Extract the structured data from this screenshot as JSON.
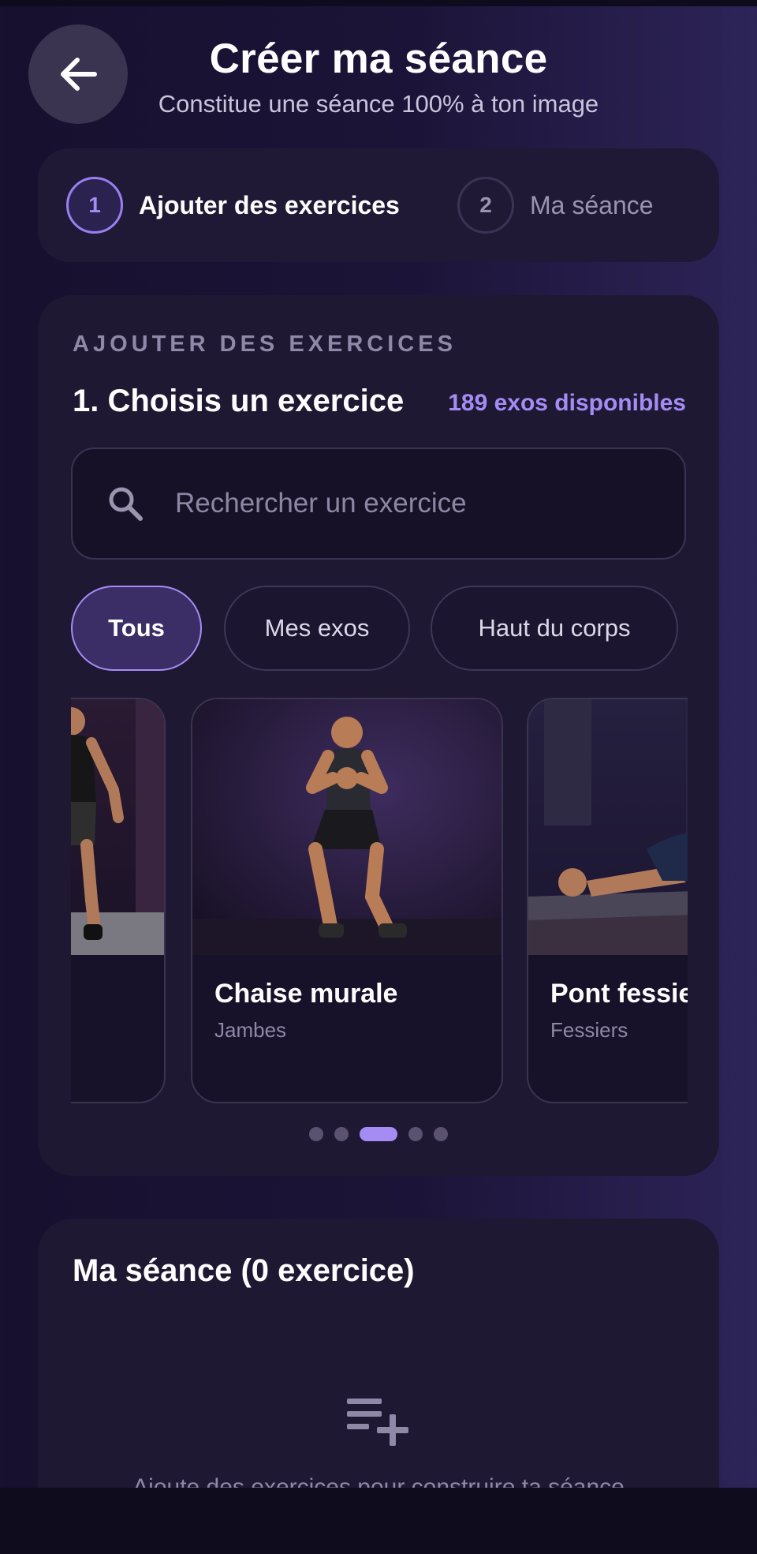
{
  "header": {
    "title": "Créer ma séance",
    "subtitle": "Constitue une séance 100% à ton image"
  },
  "stepper": {
    "steps": [
      {
        "number": "1",
        "label": "Ajouter des exercices",
        "active": true
      },
      {
        "number": "2",
        "label": "Ma séance",
        "active": false
      }
    ]
  },
  "add_section": {
    "label": "AJOUTER DES EXERCICES",
    "heading": "1.  Choisis un exercice",
    "available": "189 exos disponibles",
    "search": {
      "placeholder": "Rechercher un exercice",
      "value": ""
    },
    "filters": [
      {
        "label": "Tous",
        "active": true
      },
      {
        "label": "Mes exos",
        "active": false
      },
      {
        "label": "Haut du corps",
        "active": false
      }
    ],
    "exercises": [
      {
        "name": "",
        "category": ""
      },
      {
        "name": "Chaise murale",
        "category": "Jambes"
      },
      {
        "name": "Pont fessier",
        "category": "Fessiers"
      }
    ],
    "pagination": {
      "count": 5,
      "active_index": 2
    }
  },
  "session": {
    "title": "Ma séance (0 exercice)",
    "empty_message": "Ajoute des exercices pour construire ta séance"
  },
  "colors": {
    "accent": "#a58cf5",
    "card": "#1f1833",
    "background": "#1c1438"
  },
  "icons": [
    "back-arrow-icon",
    "search-icon",
    "playlist-add-icon"
  ]
}
